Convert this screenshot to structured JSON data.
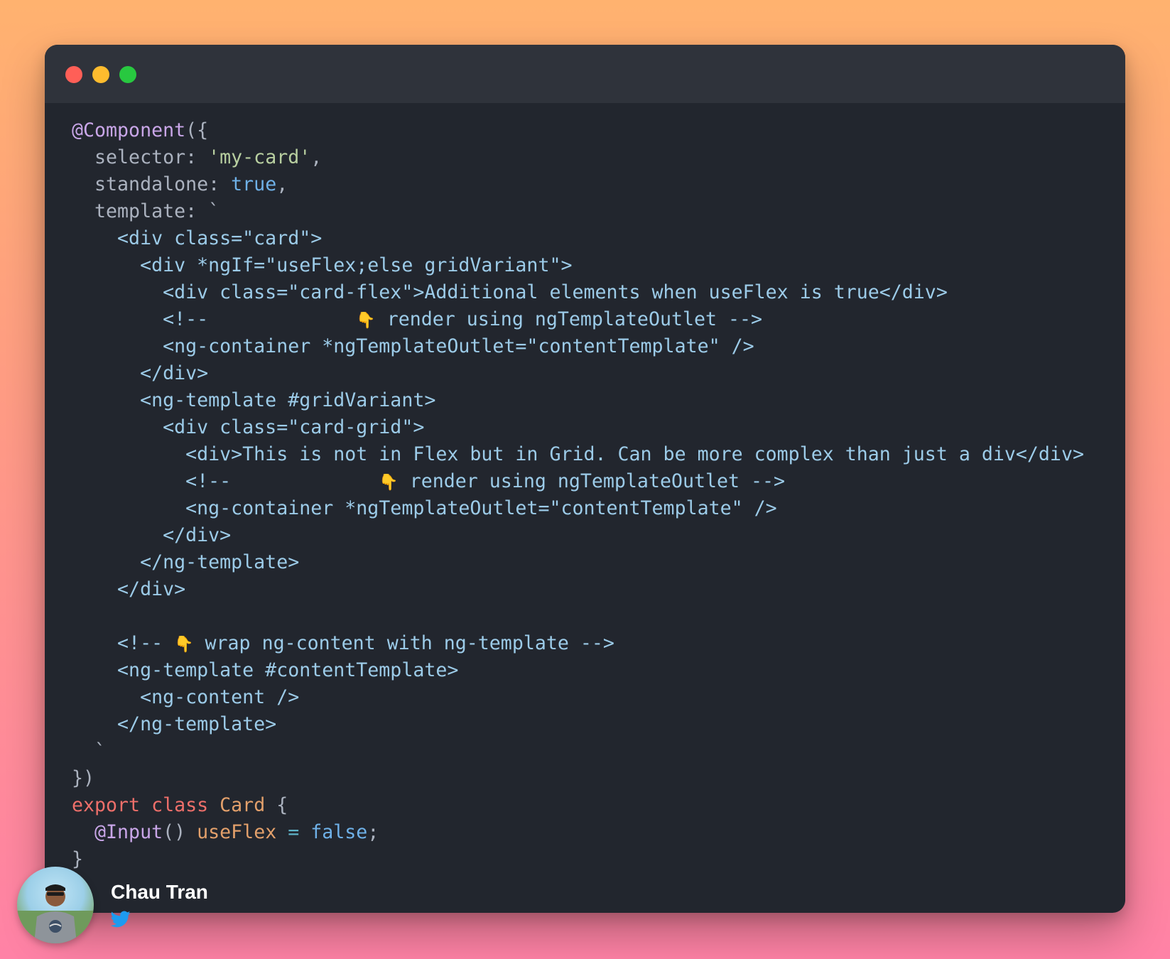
{
  "window": {
    "controls": [
      "close",
      "minimize",
      "zoom"
    ]
  },
  "code": {
    "lines": [
      [
        {
          "t": "@Component",
          "c": "deco"
        },
        {
          "t": "({",
          "c": "plain"
        }
      ],
      [
        {
          "t": "  selector: ",
          "c": "plain"
        },
        {
          "t": "'my-card'",
          "c": "str"
        },
        {
          "t": ",",
          "c": "plain"
        }
      ],
      [
        {
          "t": "  standalone: ",
          "c": "plain"
        },
        {
          "t": "true",
          "c": "bool"
        },
        {
          "t": ",",
          "c": "plain"
        }
      ],
      [
        {
          "t": "  template: `",
          "c": "plain"
        }
      ],
      [
        {
          "t": "    <div class=\"card\">",
          "c": "tmpl"
        }
      ],
      [
        {
          "t": "      <div *ngIf=\"useFlex;else gridVariant\">",
          "c": "tmpl"
        }
      ],
      [
        {
          "t": "        <div class=\"card-flex\">Additional elements when useFlex is true</div>",
          "c": "tmpl"
        }
      ],
      [
        {
          "t": "        <!--             ",
          "c": "tmpl"
        },
        {
          "t": "👇",
          "c": "emoji"
        },
        {
          "t": " render using ngTemplateOutlet -->",
          "c": "tmpl"
        }
      ],
      [
        {
          "t": "        <ng-container *ngTemplateOutlet=\"contentTemplate\" />",
          "c": "tmpl"
        }
      ],
      [
        {
          "t": "      </div>",
          "c": "tmpl"
        }
      ],
      [
        {
          "t": "      <ng-template #gridVariant>",
          "c": "tmpl"
        }
      ],
      [
        {
          "t": "        <div class=\"card-grid\">",
          "c": "tmpl"
        }
      ],
      [
        {
          "t": "          <div>This is not in Flex but in Grid. Can be more complex than just a div</div>",
          "c": "tmpl"
        }
      ],
      [
        {
          "t": "          <!--             ",
          "c": "tmpl"
        },
        {
          "t": "👇",
          "c": "emoji"
        },
        {
          "t": " render using ngTemplateOutlet -->",
          "c": "tmpl"
        }
      ],
      [
        {
          "t": "          <ng-container *ngTemplateOutlet=\"contentTemplate\" />",
          "c": "tmpl"
        }
      ],
      [
        {
          "t": "        </div>",
          "c": "tmpl"
        }
      ],
      [
        {
          "t": "      </ng-template>",
          "c": "tmpl"
        }
      ],
      [
        {
          "t": "    </div>",
          "c": "tmpl"
        }
      ],
      [
        {
          "t": "",
          "c": "plain"
        }
      ],
      [
        {
          "t": "    <!-- ",
          "c": "tmpl"
        },
        {
          "t": "👇",
          "c": "emoji"
        },
        {
          "t": " wrap ng-content with ng-template -->",
          "c": "tmpl"
        }
      ],
      [
        {
          "t": "    <ng-template #contentTemplate>",
          "c": "tmpl"
        }
      ],
      [
        {
          "t": "      <ng-content />",
          "c": "tmpl"
        }
      ],
      [
        {
          "t": "    </ng-template>",
          "c": "tmpl"
        }
      ],
      [
        {
          "t": "  `",
          "c": "plain"
        }
      ],
      [
        {
          "t": "})",
          "c": "plain"
        }
      ],
      [
        {
          "t": "export ",
          "c": "kw"
        },
        {
          "t": "class ",
          "c": "kw"
        },
        {
          "t": "Card",
          "c": "cls"
        },
        {
          "t": " {",
          "c": "plain"
        }
      ],
      [
        {
          "t": "  @Input",
          "c": "deco"
        },
        {
          "t": "() ",
          "c": "plain"
        },
        {
          "t": "useFlex",
          "c": "cls"
        },
        {
          "t": " = ",
          "c": "op"
        },
        {
          "t": "false",
          "c": "bool"
        },
        {
          "t": ";",
          "c": "plain"
        }
      ],
      [
        {
          "t": "}",
          "c": "plain"
        }
      ]
    ]
  },
  "author": {
    "name": "Chau Tran",
    "avatar_icon": "avatar-photo",
    "social_icon": "twitter-icon"
  }
}
